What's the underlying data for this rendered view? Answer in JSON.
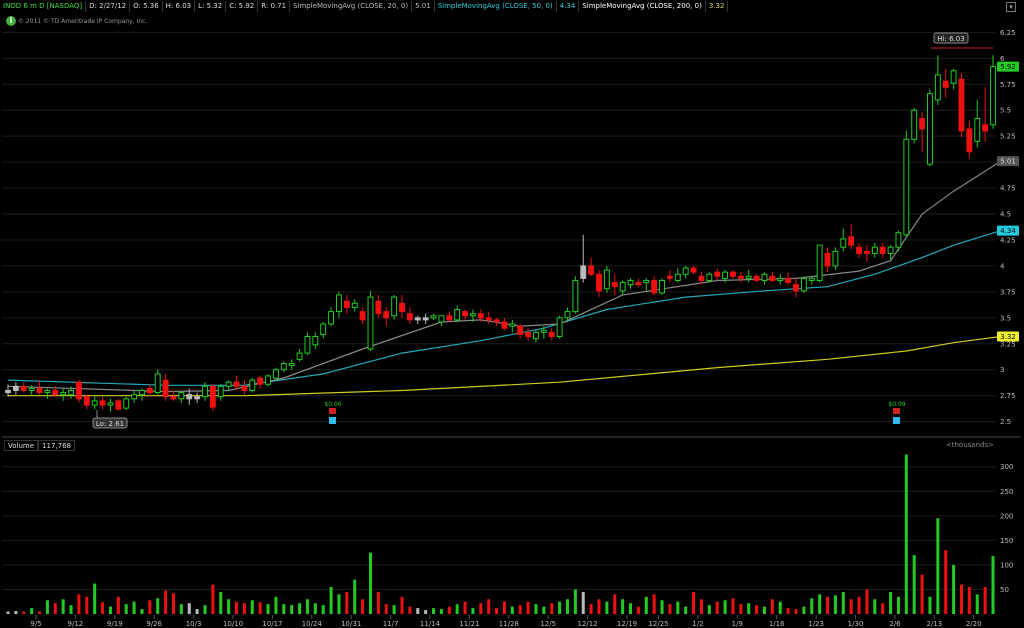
{
  "header": {
    "symbol": "INOD 6 m D [NASDAQ]",
    "date": "D: 2/27/12",
    "open": "O: 5.36",
    "high": "H: 6.03",
    "low": "L: 5.32",
    "close": "C: 5.92",
    "range": "R: 0.71",
    "sma20_label": "SimpleMovingAvg (CLOSE, 20, 0)",
    "sma20_value": "5.01",
    "sma50_label": "SimpleMovingAvg (CLOSE, 50, 0)",
    "sma50_value": "4.34",
    "sma200_label": "SimpleMovingAvg (CLOSE, 200, 0)",
    "sma200_value": "3.32",
    "expand_glyph": "▾"
  },
  "copyright": "© 2011 © TD Ameritrade IP Company, Inc.",
  "info_glyph": "i",
  "price_panel": {
    "hi_label": "Hi: 6.03",
    "lo_label": "Lo: 2.61",
    "div1": "$0.06",
    "div2": "$0.09",
    "y_ticks": [
      "6.25",
      "6",
      "5.75",
      "5.5",
      "5.25",
      "5",
      "4.75",
      "4.5",
      "4.25",
      "4",
      "3.75",
      "3.5",
      "3.25",
      "3",
      "2.75",
      "2.5"
    ],
    "price_tags": [
      {
        "text": "5.92",
        "value": 5.92,
        "color": "#22cc22",
        "fg": "#000"
      },
      {
        "text": "5.01",
        "value": 5.01,
        "color": "#555555",
        "fg": "#ddd"
      },
      {
        "text": "4.34",
        "value": 4.34,
        "color": "#22ccdd",
        "fg": "#000"
      },
      {
        "text": "3.32",
        "value": 3.32,
        "color": "#eeee33",
        "fg": "#000"
      }
    ]
  },
  "volume_panel": {
    "label": "Volume",
    "value": "117,768",
    "unit": "<thousands>",
    "y_ticks": [
      "300",
      "250",
      "200",
      "150",
      "100",
      "50"
    ]
  },
  "x_labels": [
    "9/5",
    "9/12",
    "9/19",
    "9/26",
    "10/3",
    "10/10",
    "10/17",
    "10/24",
    "10/31",
    "11/7",
    "11/14",
    "11/21",
    "11/28",
    "12/5",
    "12/12",
    "12/19",
    "12/25",
    "1/2",
    "1/9",
    "1/16",
    "1/23",
    "1/30",
    "2/6",
    "2/13",
    "2/20"
  ],
  "colors": {
    "up": "#22cc22",
    "down": "#ee1111",
    "neutral": "#bbbbbb",
    "sma20": "#888888",
    "sma50": "#22aabb",
    "sma200": "#cccc22",
    "grid": "#1e1e1e"
  },
  "chart_data": {
    "type": "candlestick",
    "title": "INOD 6 m D [NASDAQ]",
    "price_range": [
      2.4,
      6.35
    ],
    "volume_range": [
      0,
      330
    ],
    "candles": [
      [
        2.78,
        2.86,
        2.74,
        2.8,
        5,
        "n"
      ],
      [
        2.8,
        2.88,
        2.76,
        2.84,
        6,
        "n"
      ],
      [
        2.84,
        2.88,
        2.78,
        2.8,
        5,
        "d"
      ],
      [
        2.8,
        2.85,
        2.76,
        2.82,
        12,
        "u"
      ],
      [
        2.82,
        2.9,
        2.76,
        2.78,
        5,
        "d"
      ],
      [
        2.78,
        2.82,
        2.72,
        2.8,
        28,
        "u"
      ],
      [
        2.8,
        2.84,
        2.74,
        2.76,
        22,
        "d"
      ],
      [
        2.76,
        2.82,
        2.7,
        2.78,
        30,
        "u"
      ],
      [
        2.76,
        2.84,
        2.72,
        2.8,
        18,
        "u"
      ],
      [
        2.88,
        2.9,
        2.68,
        2.72,
        40,
        "d"
      ],
      [
        2.74,
        2.76,
        2.62,
        2.66,
        35,
        "d"
      ],
      [
        2.66,
        2.74,
        2.62,
        2.7,
        62,
        "u"
      ],
      [
        2.7,
        2.74,
        2.62,
        2.66,
        24,
        "d"
      ],
      [
        2.66,
        2.72,
        2.6,
        2.68,
        15,
        "u"
      ],
      [
        2.7,
        2.72,
        2.6,
        2.62,
        35,
        "d"
      ],
      [
        2.63,
        2.74,
        2.61,
        2.72,
        20,
        "u"
      ],
      [
        2.72,
        2.8,
        2.68,
        2.76,
        25,
        "u"
      ],
      [
        2.76,
        2.82,
        2.7,
        2.8,
        10,
        "u"
      ],
      [
        2.82,
        2.86,
        2.74,
        2.78,
        28,
        "d"
      ],
      [
        2.78,
        3.0,
        2.76,
        2.96,
        32,
        "u"
      ],
      [
        2.9,
        2.96,
        2.7,
        2.74,
        48,
        "d"
      ],
      [
        2.74,
        2.8,
        2.7,
        2.72,
        42,
        "d"
      ],
      [
        2.72,
        2.8,
        2.68,
        2.78,
        20,
        "u"
      ],
      [
        2.76,
        2.82,
        2.66,
        2.72,
        22,
        "n"
      ],
      [
        2.72,
        2.78,
        2.68,
        2.74,
        10,
        "n"
      ],
      [
        2.74,
        2.88,
        2.7,
        2.84,
        18,
        "u"
      ],
      [
        2.84,
        2.86,
        2.6,
        2.64,
        60,
        "d"
      ],
      [
        2.74,
        2.86,
        2.7,
        2.84,
        45,
        "u"
      ],
      [
        2.84,
        2.9,
        2.8,
        2.88,
        30,
        "u"
      ],
      [
        2.88,
        2.94,
        2.8,
        2.84,
        25,
        "d"
      ],
      [
        2.84,
        2.9,
        2.76,
        2.8,
        22,
        "d"
      ],
      [
        2.8,
        2.92,
        2.78,
        2.9,
        28,
        "u"
      ],
      [
        2.92,
        2.94,
        2.82,
        2.86,
        24,
        "d"
      ],
      [
        2.86,
        2.96,
        2.84,
        2.94,
        20,
        "u"
      ],
      [
        2.92,
        3.02,
        2.9,
        3.0,
        35,
        "u"
      ],
      [
        3.0,
        3.08,
        2.98,
        3.06,
        20,
        "u"
      ],
      [
        3.04,
        3.1,
        3.0,
        3.06,
        18,
        "u"
      ],
      [
        3.1,
        3.2,
        3.08,
        3.16,
        22,
        "u"
      ],
      [
        3.16,
        3.36,
        3.14,
        3.32,
        30,
        "u"
      ],
      [
        3.24,
        3.36,
        3.2,
        3.32,
        22,
        "u"
      ],
      [
        3.34,
        3.46,
        3.3,
        3.44,
        18,
        "u"
      ],
      [
        3.44,
        3.6,
        3.42,
        3.56,
        55,
        "u"
      ],
      [
        3.56,
        3.75,
        3.5,
        3.72,
        40,
        "u"
      ],
      [
        3.66,
        3.72,
        3.54,
        3.6,
        45,
        "d"
      ],
      [
        3.6,
        3.68,
        3.56,
        3.64,
        70,
        "u"
      ],
      [
        3.56,
        3.6,
        3.44,
        3.48,
        30,
        "d"
      ],
      [
        3.2,
        3.76,
        3.18,
        3.7,
        125,
        "u"
      ],
      [
        3.66,
        3.72,
        3.5,
        3.54,
        45,
        "d"
      ],
      [
        3.56,
        3.6,
        3.42,
        3.5,
        20,
        "d"
      ],
      [
        3.52,
        3.72,
        3.48,
        3.7,
        18,
        "u"
      ],
      [
        3.64,
        3.72,
        3.5,
        3.56,
        35,
        "d"
      ],
      [
        3.54,
        3.6,
        3.44,
        3.48,
        15,
        "d"
      ],
      [
        3.48,
        3.52,
        3.44,
        3.5,
        12,
        "n"
      ],
      [
        3.48,
        3.54,
        3.44,
        3.5,
        8,
        "n"
      ],
      [
        3.52,
        3.54,
        3.48,
        3.5,
        12,
        "u"
      ],
      [
        3.46,
        3.52,
        3.42,
        3.52,
        10,
        "u"
      ],
      [
        3.52,
        3.56,
        3.46,
        3.48,
        15,
        "d"
      ],
      [
        3.48,
        3.62,
        3.46,
        3.58,
        20,
        "u"
      ],
      [
        3.56,
        3.58,
        3.48,
        3.52,
        25,
        "d"
      ],
      [
        3.52,
        3.58,
        3.46,
        3.54,
        12,
        "u"
      ],
      [
        3.54,
        3.58,
        3.46,
        3.5,
        22,
        "d"
      ],
      [
        3.5,
        3.56,
        3.44,
        3.48,
        30,
        "d"
      ],
      [
        3.48,
        3.5,
        3.42,
        3.46,
        12,
        "d"
      ],
      [
        3.46,
        3.5,
        3.38,
        3.4,
        25,
        "d"
      ],
      [
        3.42,
        3.48,
        3.36,
        3.44,
        15,
        "u"
      ],
      [
        3.42,
        3.44,
        3.3,
        3.34,
        18,
        "d"
      ],
      [
        3.36,
        3.4,
        3.28,
        3.32,
        25,
        "d"
      ],
      [
        3.3,
        3.38,
        3.26,
        3.36,
        20,
        "u"
      ],
      [
        3.36,
        3.42,
        3.3,
        3.38,
        15,
        "u"
      ],
      [
        3.36,
        3.4,
        3.28,
        3.32,
        22,
        "d"
      ],
      [
        3.32,
        3.52,
        3.3,
        3.5,
        25,
        "u"
      ],
      [
        3.5,
        3.6,
        3.46,
        3.56,
        30,
        "u"
      ],
      [
        3.56,
        3.9,
        3.54,
        3.86,
        50,
        "u"
      ],
      [
        3.88,
        4.3,
        3.84,
        4.0,
        45,
        "n"
      ],
      [
        4.0,
        4.08,
        3.9,
        3.92,
        20,
        "d"
      ],
      [
        3.92,
        3.96,
        3.7,
        3.76,
        30,
        "d"
      ],
      [
        3.78,
        4.0,
        3.74,
        3.96,
        25,
        "u"
      ],
      [
        3.84,
        3.92,
        3.72,
        3.8,
        40,
        "d"
      ],
      [
        3.76,
        3.86,
        3.72,
        3.84,
        30,
        "u"
      ],
      [
        3.82,
        3.88,
        3.78,
        3.86,
        22,
        "u"
      ],
      [
        3.84,
        3.88,
        3.8,
        3.82,
        15,
        "d"
      ],
      [
        3.84,
        3.88,
        3.76,
        3.86,
        35,
        "u"
      ],
      [
        3.86,
        3.9,
        3.72,
        3.74,
        40,
        "d"
      ],
      [
        3.74,
        3.88,
        3.72,
        3.86,
        28,
        "u"
      ],
      [
        3.9,
        3.96,
        3.84,
        3.88,
        20,
        "d"
      ],
      [
        3.86,
        3.98,
        3.84,
        3.92,
        25,
        "u"
      ],
      [
        3.92,
        4.0,
        3.88,
        3.98,
        15,
        "u"
      ],
      [
        3.98,
        4.0,
        3.92,
        3.94,
        45,
        "d"
      ],
      [
        3.9,
        3.94,
        3.82,
        3.86,
        30,
        "d"
      ],
      [
        3.86,
        3.94,
        3.84,
        3.92,
        18,
        "u"
      ],
      [
        3.94,
        3.98,
        3.86,
        3.9,
        25,
        "d"
      ],
      [
        3.88,
        3.96,
        3.84,
        3.94,
        28,
        "u"
      ],
      [
        3.94,
        3.96,
        3.88,
        3.9,
        32,
        "d"
      ],
      [
        3.9,
        3.94,
        3.84,
        3.88,
        20,
        "d"
      ],
      [
        3.88,
        3.96,
        3.84,
        3.9,
        22,
        "u"
      ],
      [
        3.9,
        3.92,
        3.84,
        3.86,
        18,
        "d"
      ],
      [
        3.86,
        3.94,
        3.82,
        3.92,
        15,
        "u"
      ],
      [
        3.9,
        3.94,
        3.84,
        3.86,
        30,
        "d"
      ],
      [
        3.86,
        3.92,
        3.82,
        3.88,
        25,
        "u"
      ],
      [
        3.88,
        3.94,
        3.82,
        3.84,
        12,
        "d"
      ],
      [
        3.82,
        3.88,
        3.7,
        3.76,
        10,
        "d"
      ],
      [
        3.76,
        3.9,
        3.74,
        3.88,
        15,
        "u"
      ],
      [
        3.86,
        3.9,
        3.82,
        3.88,
        32,
        "u"
      ],
      [
        3.86,
        4.2,
        3.84,
        4.2,
        40,
        "u"
      ],
      [
        4.12,
        4.18,
        3.94,
        4.0,
        35,
        "d"
      ],
      [
        4.0,
        4.18,
        3.96,
        4.14,
        38,
        "u"
      ],
      [
        4.18,
        4.36,
        4.14,
        4.26,
        45,
        "u"
      ],
      [
        4.28,
        4.4,
        4.16,
        4.2,
        30,
        "d"
      ],
      [
        4.18,
        4.22,
        4.08,
        4.12,
        35,
        "d"
      ],
      [
        4.14,
        4.2,
        4.04,
        4.12,
        50,
        "d"
      ],
      [
        4.12,
        4.22,
        4.08,
        4.18,
        30,
        "u"
      ],
      [
        4.18,
        4.22,
        4.08,
        4.12,
        22,
        "d"
      ],
      [
        4.12,
        4.2,
        4.06,
        4.18,
        45,
        "u"
      ],
      [
        4.18,
        4.34,
        4.14,
        4.32,
        35,
        "u"
      ],
      [
        4.3,
        5.3,
        4.28,
        5.22,
        325,
        "u"
      ],
      [
        5.22,
        5.52,
        5.18,
        5.5,
        120,
        "u"
      ],
      [
        5.42,
        5.48,
        5.1,
        5.32,
        80,
        "d"
      ],
      [
        4.98,
        5.7,
        4.96,
        5.66,
        35,
        "u"
      ],
      [
        5.6,
        6.03,
        5.55,
        5.84,
        195,
        "u"
      ],
      [
        5.78,
        5.9,
        5.62,
        5.72,
        130,
        "d"
      ],
      [
        5.76,
        5.9,
        5.7,
        5.88,
        100,
        "u"
      ],
      [
        5.8,
        5.86,
        5.24,
        5.3,
        60,
        "d"
      ],
      [
        5.32,
        5.4,
        5.04,
        5.1,
        55,
        "d"
      ],
      [
        5.2,
        5.6,
        5.14,
        5.42,
        40,
        "u"
      ],
      [
        5.3,
        5.72,
        5.2,
        5.36,
        55,
        "d"
      ],
      [
        5.36,
        6.03,
        5.32,
        5.92,
        118,
        "u"
      ]
    ],
    "sma20": [
      [
        0,
        2.84
      ],
      [
        20,
        2.79
      ],
      [
        28,
        2.8
      ],
      [
        35,
        2.92
      ],
      [
        45,
        3.2
      ],
      [
        55,
        3.46
      ],
      [
        60,
        3.48
      ],
      [
        65,
        3.42
      ],
      [
        70,
        3.44
      ],
      [
        78,
        3.72
      ],
      [
        90,
        3.86
      ],
      [
        100,
        3.88
      ],
      [
        108,
        3.95
      ],
      [
        112,
        4.05
      ],
      [
        116,
        4.5
      ],
      [
        120,
        4.72
      ],
      [
        126,
        5.01
      ]
    ],
    "sma50": [
      [
        0,
        2.9
      ],
      [
        20,
        2.85
      ],
      [
        30,
        2.85
      ],
      [
        40,
        2.96
      ],
      [
        50,
        3.16
      ],
      [
        60,
        3.28
      ],
      [
        68,
        3.4
      ],
      [
        76,
        3.58
      ],
      [
        86,
        3.7
      ],
      [
        96,
        3.76
      ],
      [
        104,
        3.8
      ],
      [
        110,
        3.92
      ],
      [
        116,
        4.08
      ],
      [
        120,
        4.2
      ],
      [
        126,
        4.34
      ]
    ],
    "sma200": [
      [
        0,
        2.75
      ],
      [
        30,
        2.75
      ],
      [
        50,
        2.8
      ],
      [
        70,
        2.88
      ],
      [
        90,
        3.02
      ],
      [
        104,
        3.1
      ],
      [
        114,
        3.18
      ],
      [
        120,
        3.26
      ],
      [
        126,
        3.32
      ]
    ]
  }
}
